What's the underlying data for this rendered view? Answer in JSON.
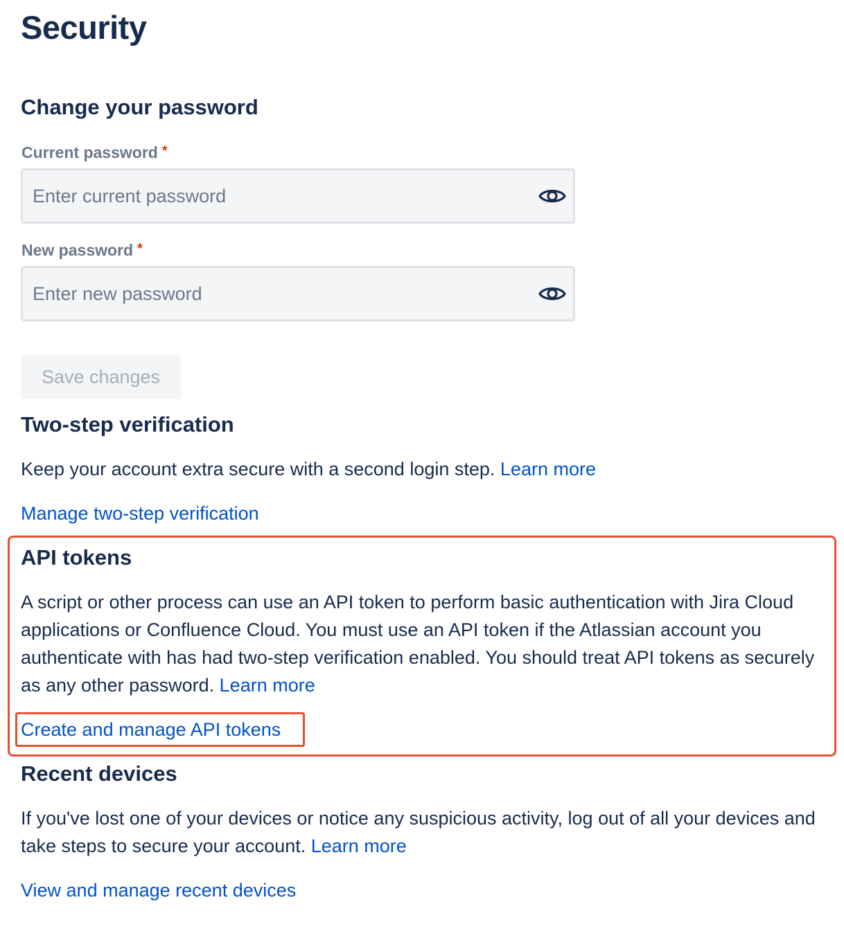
{
  "page": {
    "title": "Security"
  },
  "password": {
    "heading": "Change your password",
    "current_label": "Current password",
    "current_placeholder": "Enter current password",
    "new_label": "New password",
    "new_placeholder": "Enter new password",
    "required_marker": "*",
    "save_label": "Save changes"
  },
  "two_step": {
    "heading": "Two-step verification",
    "description": "Keep your account extra secure with a second login step. ",
    "learn_more": "Learn more",
    "manage_link": "Manage two-step verification"
  },
  "api_tokens": {
    "heading": "API tokens",
    "description": "A script or other process can use an API token to perform basic authentication with Jira Cloud applications or Confluence Cloud. You must use an API token if the Atlassian account you authenticate with has had two-step verification enabled. You should treat API tokens as securely as any other password. ",
    "learn_more": "Learn more",
    "manage_link": "Create and manage API tokens"
  },
  "recent_devices": {
    "heading": "Recent devices",
    "description": "If you've lost one of your devices or notice any suspicious activity, log out of all your devices and take steps to secure your account. ",
    "learn_more": "Learn more",
    "manage_link": "View and manage recent devices"
  },
  "icons": {
    "password_toggle": "eye-icon"
  },
  "colors": {
    "text": "#172b4d",
    "muted": "#6b778c",
    "link": "#0052cc",
    "required": "#de350b",
    "highlight": "#e4512b",
    "disabled_text": "#a5adba",
    "input_bg": "#f4f5f7"
  }
}
